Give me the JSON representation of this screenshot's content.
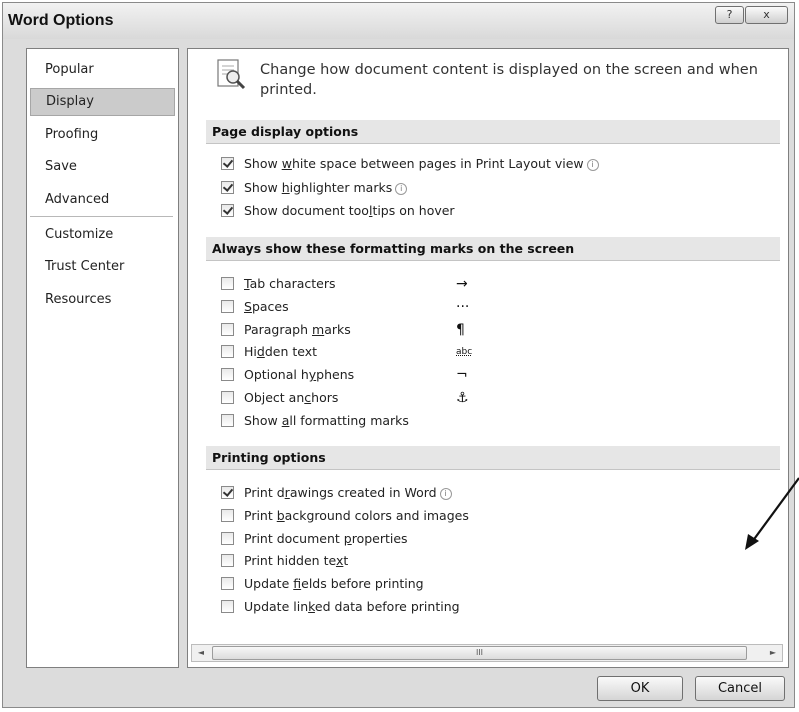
{
  "window": {
    "title": "Word Options",
    "help_btn": "?",
    "close_btn": "x"
  },
  "sidebar": {
    "items": [
      {
        "label": "Popular"
      },
      {
        "label": "Display",
        "selected": true
      },
      {
        "label": "Proofing"
      },
      {
        "label": "Save"
      },
      {
        "label": "Advanced"
      },
      {
        "label": "Customize"
      },
      {
        "label": "Trust Center"
      },
      {
        "label": "Resources"
      }
    ]
  },
  "header": {
    "text": "Change how document content is displayed on the screen and when printed."
  },
  "sections": {
    "page_display": {
      "title": "Page display options",
      "options": [
        {
          "pre": "Show ",
          "acc": "w",
          "post": "hite space between pages in Print Layout view",
          "checked": true,
          "info": true
        },
        {
          "pre": "Show ",
          "acc": "h",
          "post": "ighlighter marks",
          "checked": true,
          "info": true
        },
        {
          "pre": "Show document too",
          "acc": "l",
          "post": "tips on hover",
          "checked": true,
          "info": false
        }
      ]
    },
    "formatting": {
      "title": "Always show these formatting marks on the screen",
      "options": [
        {
          "pre": "",
          "acc": "T",
          "post": "ab characters",
          "checked": false,
          "symbol": "→"
        },
        {
          "pre": "",
          "acc": "S",
          "post": "paces",
          "checked": false,
          "symbol": "···"
        },
        {
          "pre": "Paragraph ",
          "acc": "m",
          "post": "arks",
          "checked": false,
          "symbol": "¶"
        },
        {
          "pre": "Hi",
          "acc": "d",
          "post": "den text",
          "checked": false,
          "symbol": "abc"
        },
        {
          "pre": "Optional h",
          "acc": "y",
          "post": "phens",
          "checked": false,
          "symbol": "¬"
        },
        {
          "pre": "Object an",
          "acc": "c",
          "post": "hors",
          "checked": false,
          "symbol": "⚓"
        },
        {
          "pre": "Show ",
          "acc": "a",
          "post": "ll formatting marks",
          "checked": false,
          "symbol": ""
        }
      ]
    },
    "printing": {
      "title": "Printing options",
      "options": [
        {
          "pre": "Print d",
          "acc": "r",
          "post": "awings created in Word",
          "checked": true,
          "info": true
        },
        {
          "pre": "Print ",
          "acc": "b",
          "post": "ackground colors and images",
          "checked": false,
          "info": false
        },
        {
          "pre": "Print document ",
          "acc": "p",
          "post": "roperties",
          "checked": false,
          "info": false
        },
        {
          "pre": "Print hidden te",
          "acc": "x",
          "post": "t",
          "checked": false,
          "info": false
        },
        {
          "pre": "Update ",
          "acc": "f",
          "post": "ields before printing",
          "checked": false,
          "info": false
        },
        {
          "pre": "Update lin",
          "acc": "k",
          "post": "ed data before printing",
          "checked": false,
          "info": false
        }
      ]
    }
  },
  "scrollbar": {
    "left": "◄",
    "right": "►",
    "grip": "III"
  },
  "buttons": {
    "ok": "OK",
    "cancel": "Cancel"
  },
  "colors": {
    "selected_nav": "#cbcbcb",
    "section_band": "#e6e6e6"
  }
}
